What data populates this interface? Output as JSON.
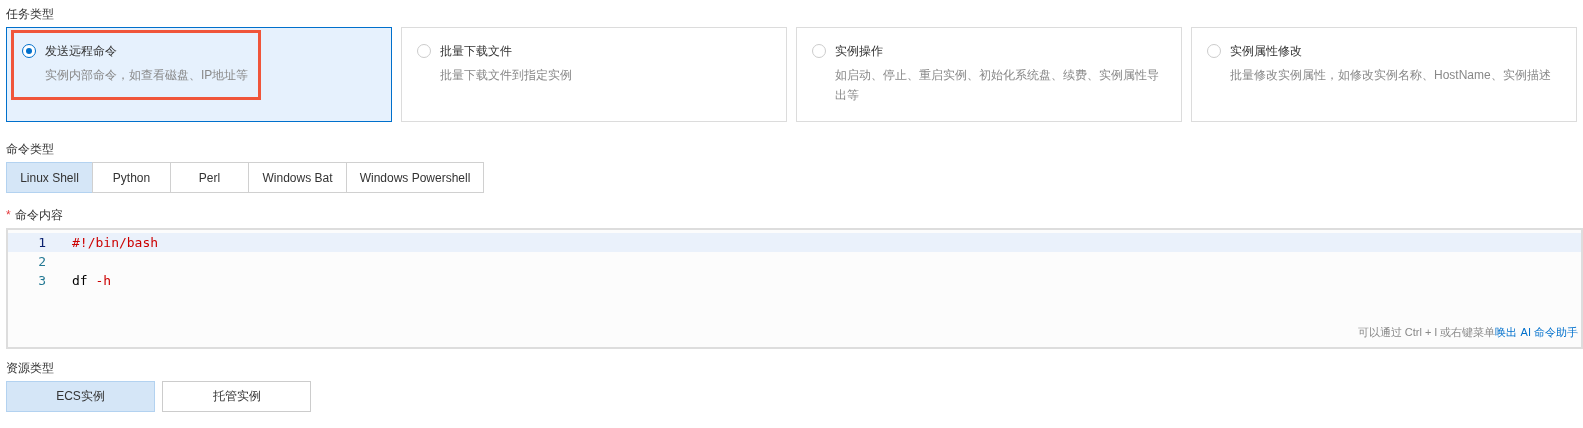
{
  "task_type": {
    "label": "任务类型",
    "options": [
      {
        "title": "发送远程命令",
        "description": "实例内部命令，如查看磁盘、IP地址等",
        "selected": true,
        "highlighted": true
      },
      {
        "title": "批量下载文件",
        "description": "批量下载文件到指定实例",
        "selected": false,
        "highlighted": false
      },
      {
        "title": "实例操作",
        "description": "如启动、停止、重启实例、初始化系统盘、续费、实例属性导出等",
        "selected": false,
        "highlighted": false
      },
      {
        "title": "实例属性修改",
        "description": "批量修改实例属性，如修改实例名称、HostName、实例描述",
        "selected": false,
        "highlighted": false
      }
    ]
  },
  "command_type": {
    "label": "命令类型",
    "options": [
      {
        "label": "Linux Shell",
        "selected": true
      },
      {
        "label": "Python",
        "selected": false
      },
      {
        "label": "Perl",
        "selected": false
      },
      {
        "label": "Windows Bat",
        "selected": false
      },
      {
        "label": "Windows Powershell",
        "selected": false
      }
    ]
  },
  "command_content": {
    "required_mark": "*",
    "label": "命令内容",
    "lines": [
      {
        "number": "1",
        "active": true,
        "tokens": [
          {
            "kind": "shebang",
            "text": "#!/bin/bash"
          }
        ]
      },
      {
        "number": "2",
        "active": false
      },
      {
        "number": "3",
        "active": false,
        "tokens": [
          {
            "kind": "plain",
            "text": "df"
          },
          {
            "kind": "flag",
            "text": "-h"
          }
        ]
      }
    ],
    "hint": "可以通过 Ctrl + I 或右键菜单",
    "hint_link": "唤出 AI 命令助手"
  },
  "resource_type": {
    "label": "资源类型",
    "options": [
      {
        "label": "ECS实例",
        "selected": true
      },
      {
        "label": "托管实例",
        "selected": false
      }
    ]
  }
}
